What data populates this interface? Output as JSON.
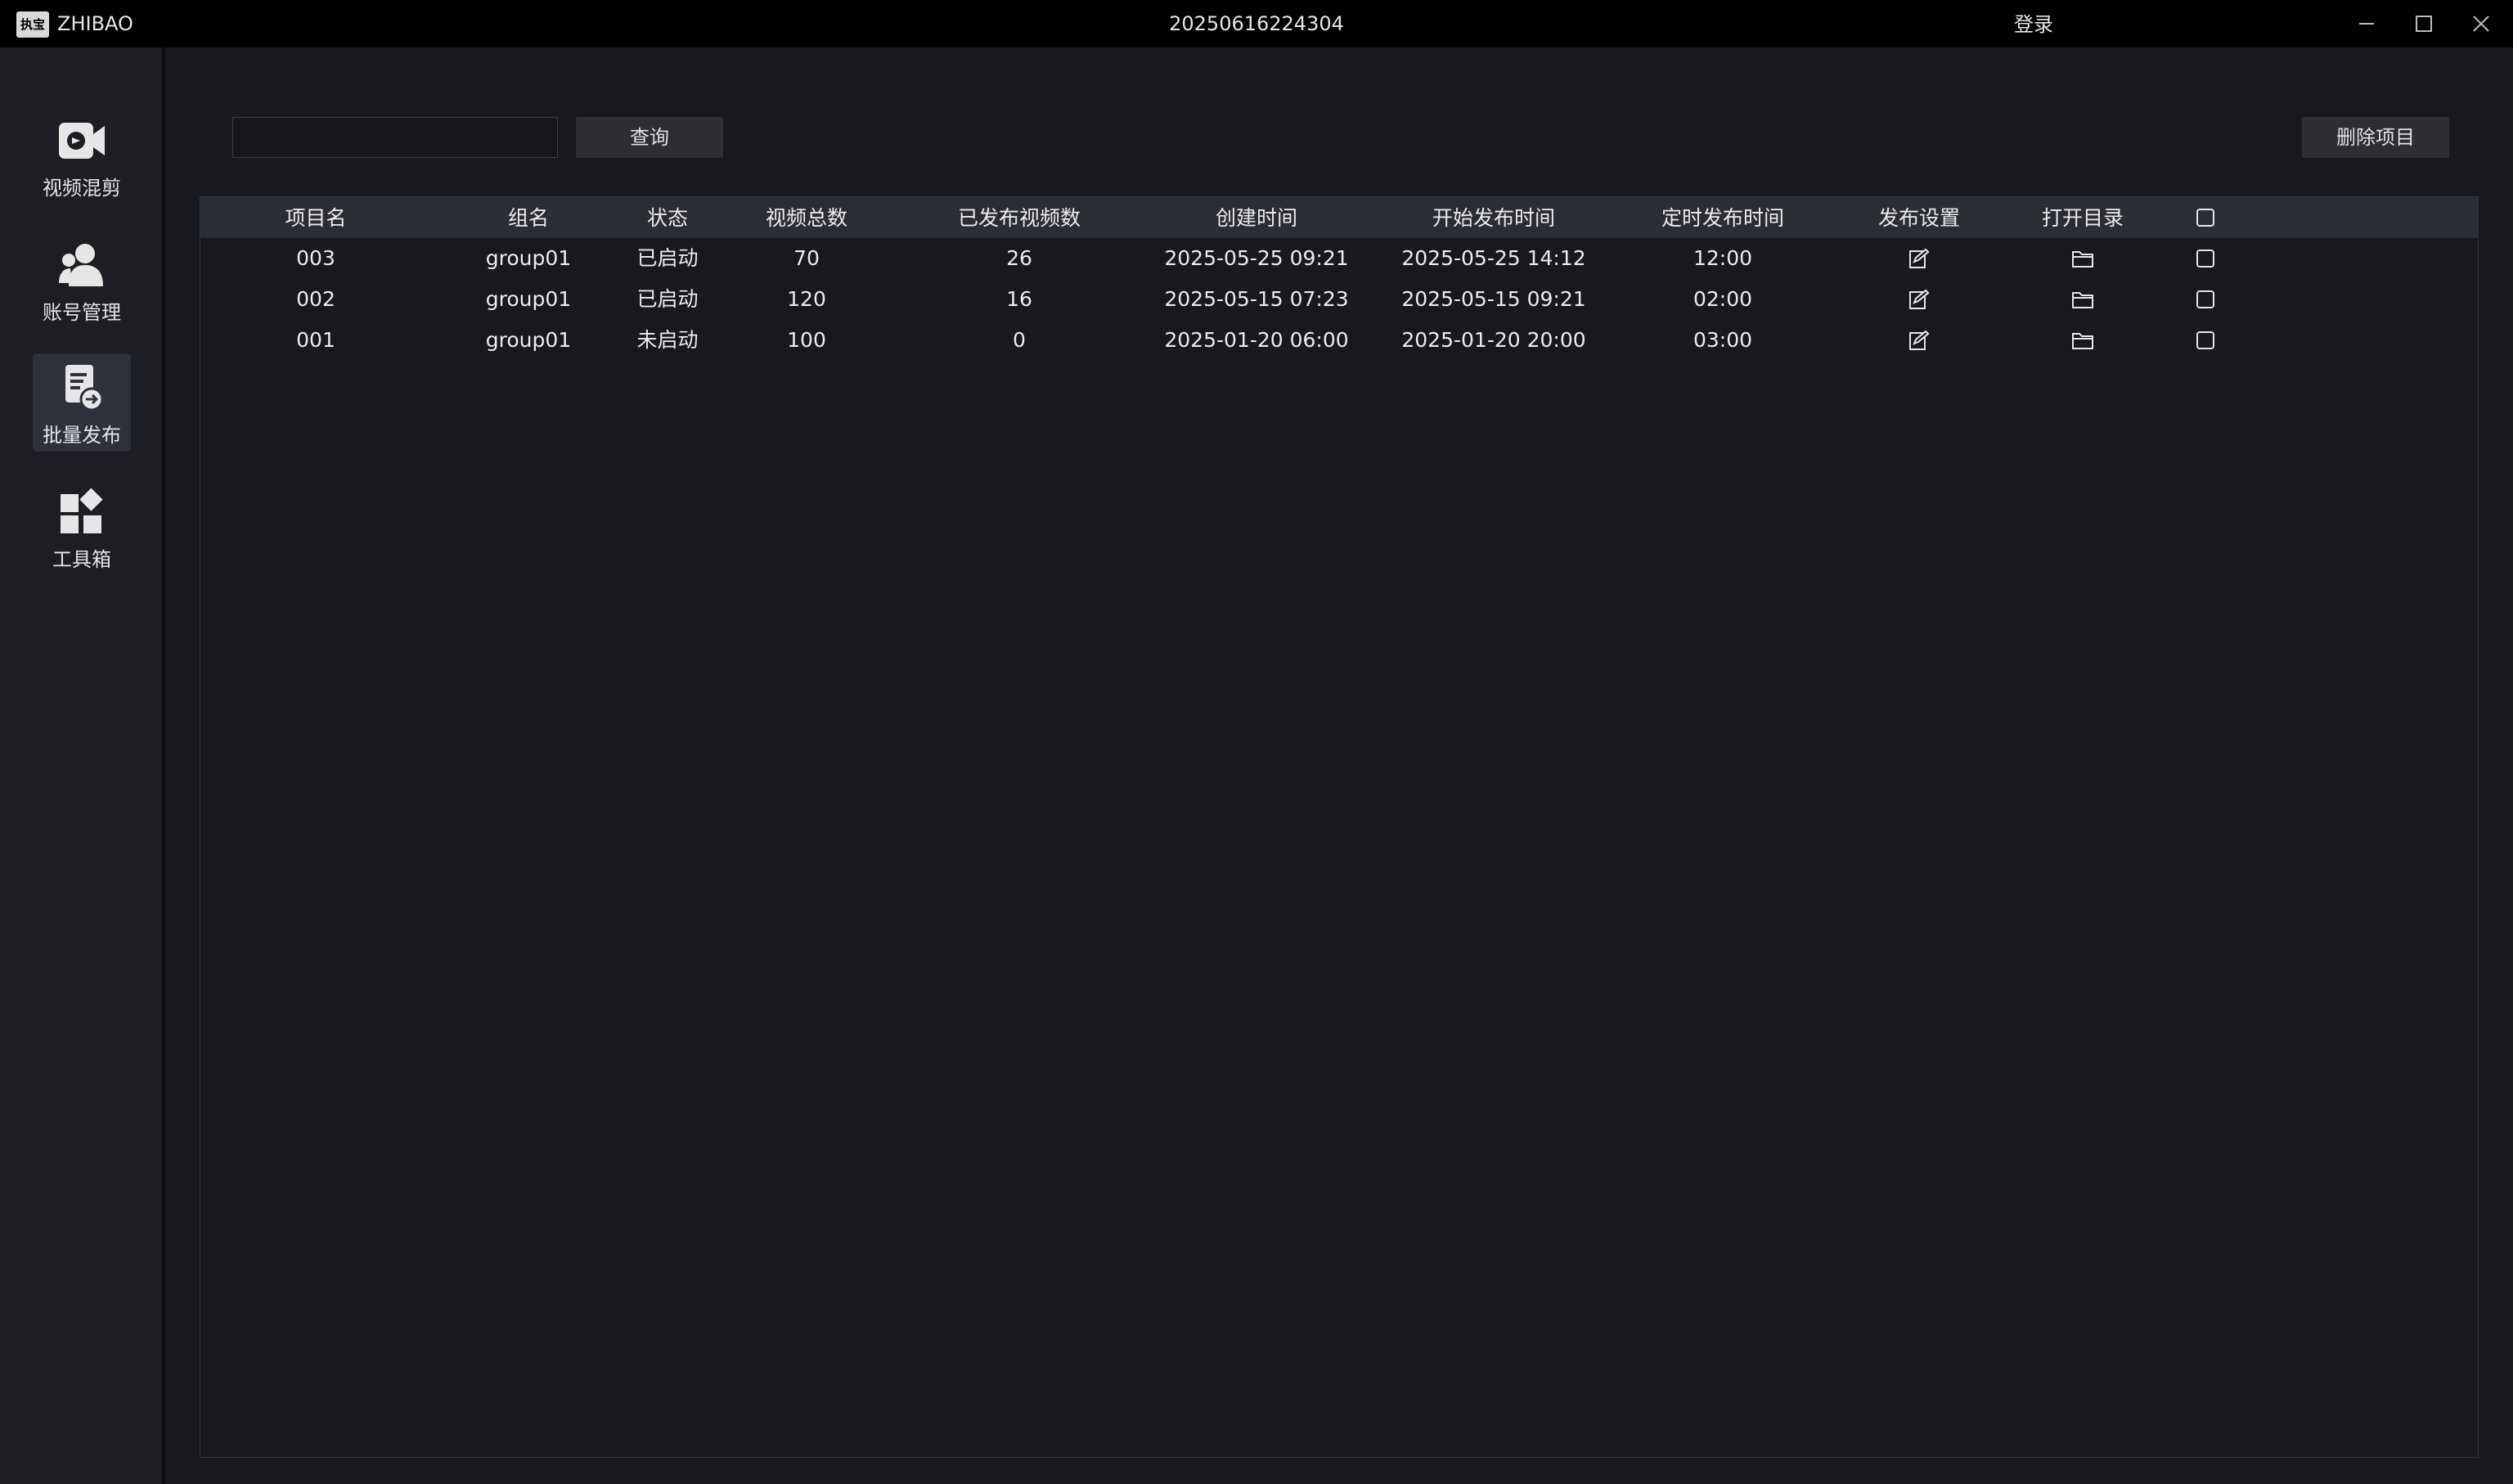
{
  "titlebar": {
    "logo_text": "执宝",
    "app_name": "ZHIBAO",
    "window_title": "20250616224304",
    "login_label": "登录",
    "controls": [
      "minimize-icon",
      "maximize-icon",
      "close-icon"
    ]
  },
  "sidebar": {
    "items": [
      {
        "label": "视频混剪",
        "icon": "video-edit-icon",
        "active": false
      },
      {
        "label": "账号管理",
        "icon": "account-icon",
        "active": false
      },
      {
        "label": "批量发布",
        "icon": "batch-publish-icon",
        "active": true
      },
      {
        "label": "工具箱",
        "icon": "toolbox-icon",
        "active": false
      }
    ]
  },
  "toolbar": {
    "search_value": "",
    "search_placeholder": "",
    "query_label": "查询",
    "delete_label": "删除项目"
  },
  "table": {
    "headers": [
      "项目名",
      "组名",
      "状态",
      "视频总数",
      "已发布视频数",
      "创建时间",
      "开始发布时间",
      "定时发布时间",
      "发布设置",
      "打开目录"
    ],
    "rows": [
      {
        "project": "003",
        "group": "group01",
        "status": "已启动",
        "total": "70",
        "published": "26",
        "created": "2025-05-25 09:21",
        "start": "2025-05-25 14:12",
        "schedule": "12:00"
      },
      {
        "project": "002",
        "group": "group01",
        "status": "已启动",
        "total": "120",
        "published": "16",
        "created": "2025-05-15 07:23",
        "start": "2025-05-15 09:21",
        "schedule": "02:00"
      },
      {
        "project": "001",
        "group": "group01",
        "status": "未启动",
        "total": "100",
        "published": "0",
        "created": "2025-01-20 06:00",
        "start": "2025-01-20 20:00",
        "schedule": "03:00"
      }
    ]
  }
}
